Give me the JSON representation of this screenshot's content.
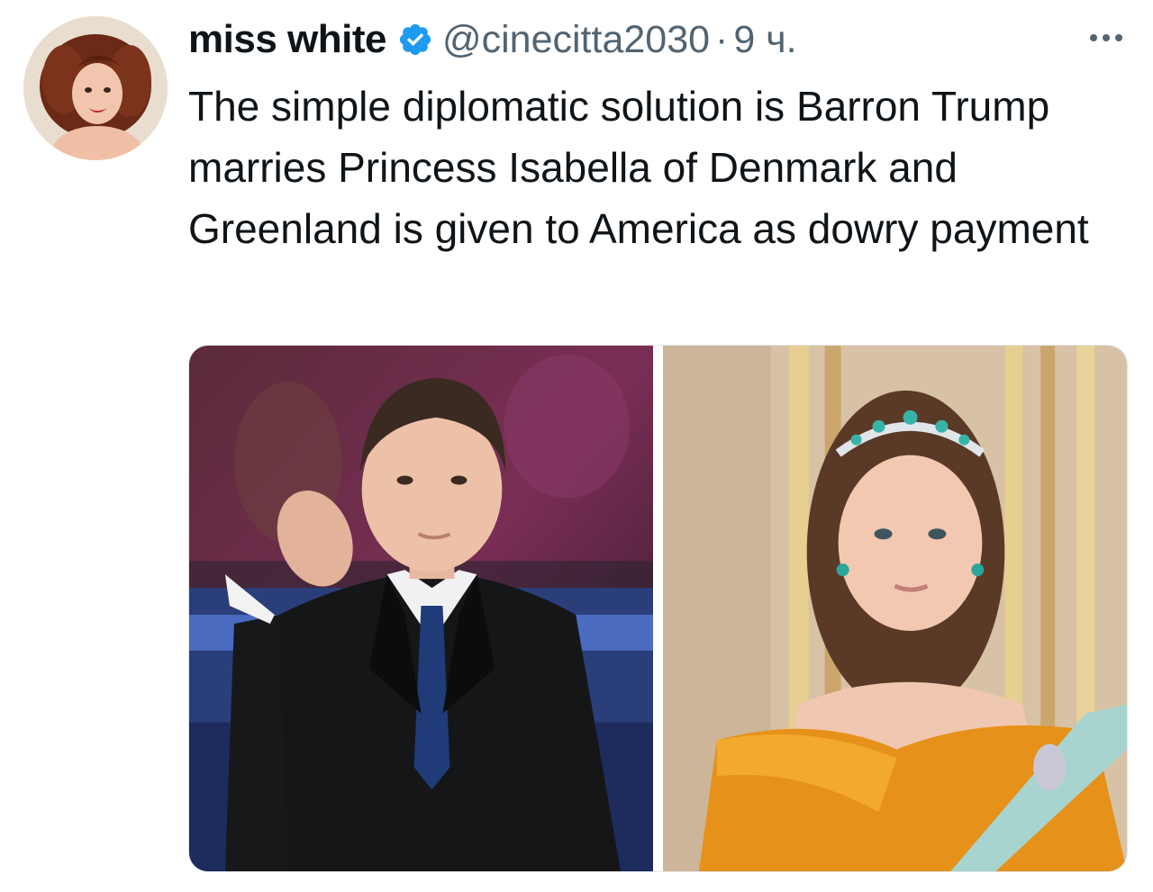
{
  "tweet": {
    "author": {
      "display_name": "miss white",
      "handle": "@cinecitta2030",
      "verified": true,
      "avatar": "profile-portrait-avatar"
    },
    "separator": "·",
    "time": "9 ч.",
    "more_icon": "ellipsis-icon",
    "text": "The simple diplomatic solution is Barron Trump marries Princess Isabella of Denmark and Greenland is given to America as dowry payment",
    "media": [
      {
        "kind": "photo"
      },
      {
        "kind": "photo"
      }
    ]
  },
  "colors": {
    "text_primary": "#0f1419",
    "text_secondary": "#536471",
    "verified_blue": "#1d9bf0"
  }
}
